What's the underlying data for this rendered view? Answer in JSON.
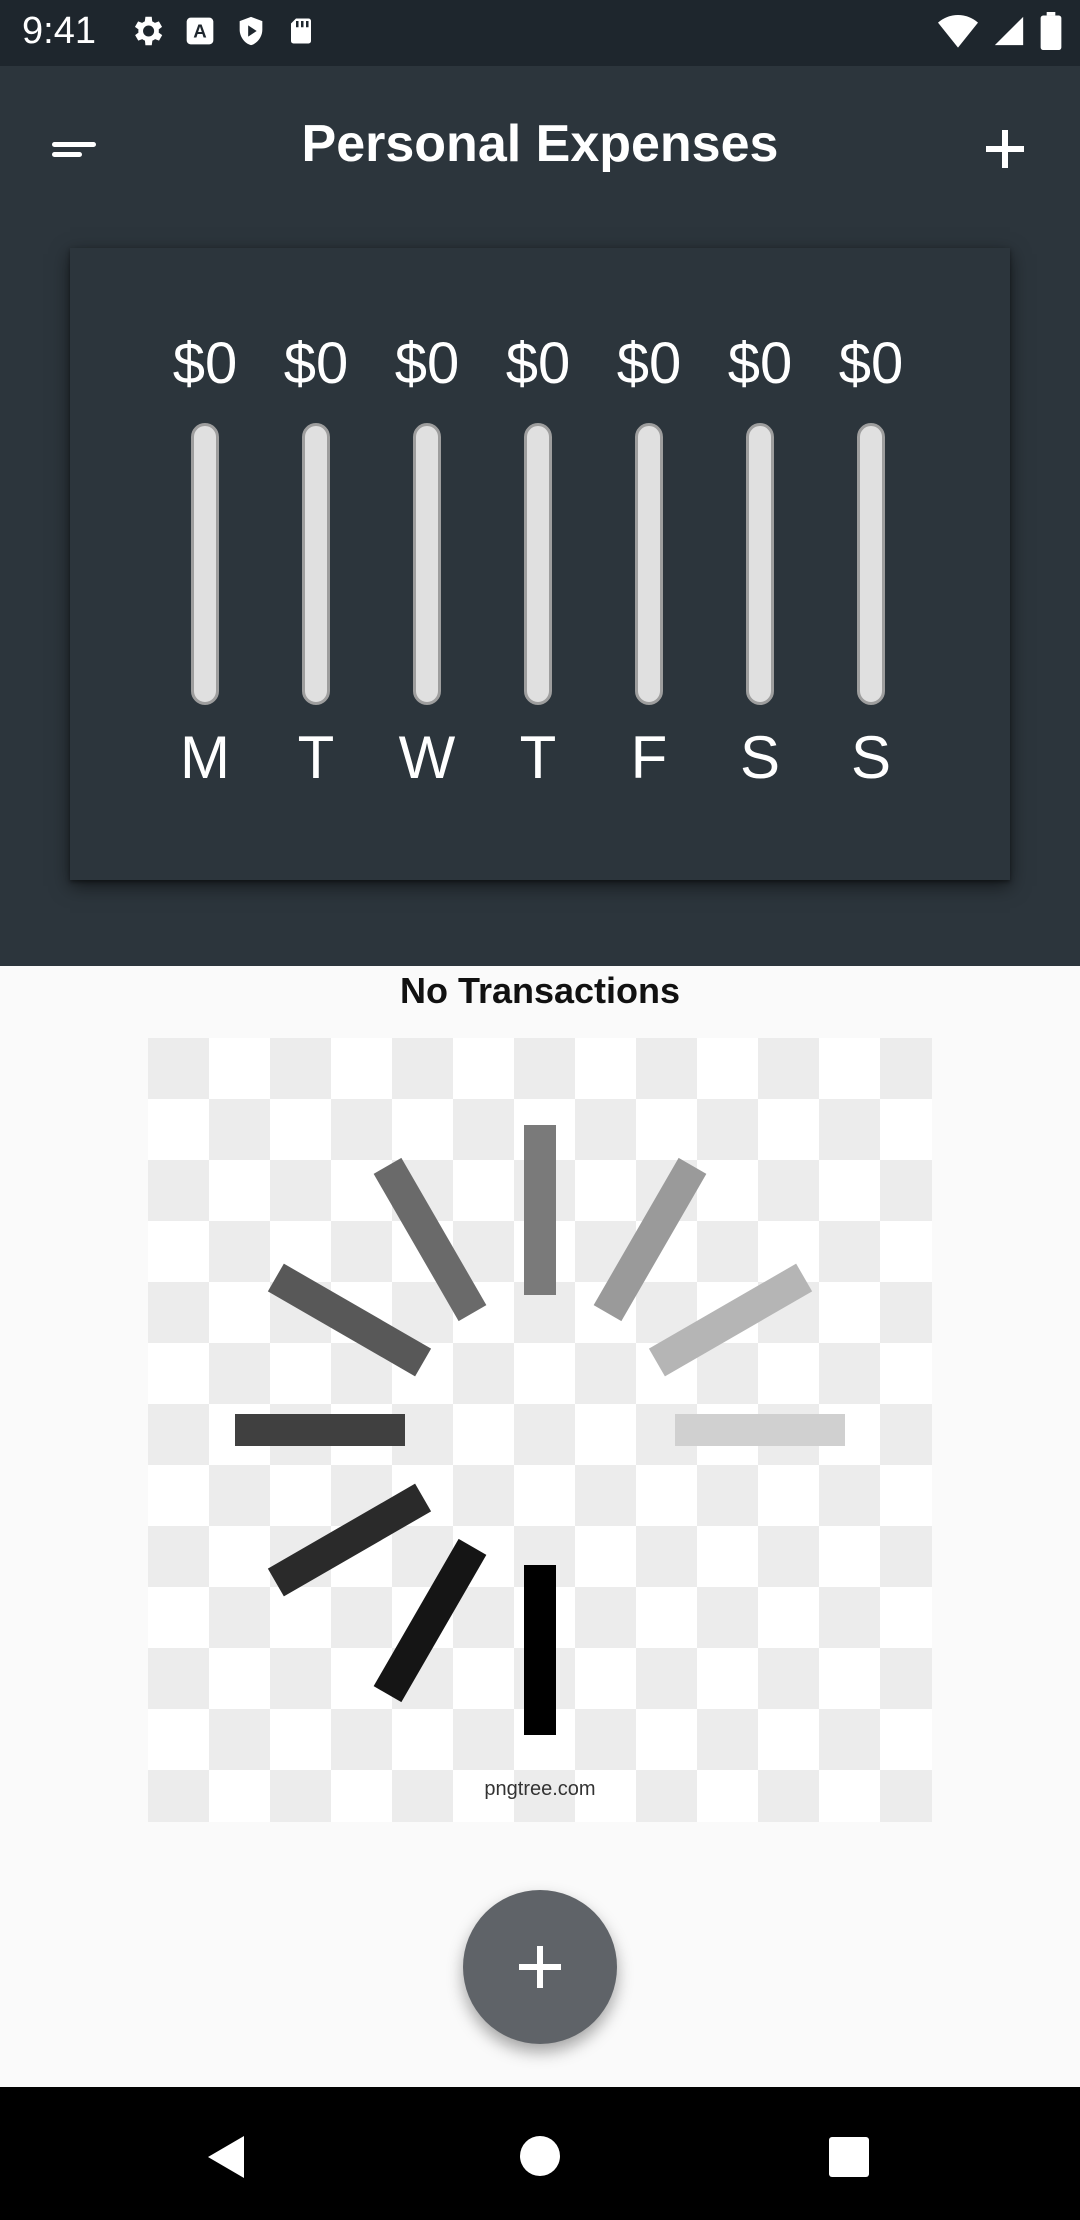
{
  "status_bar": {
    "time": "9:41",
    "left_icons": [
      "settings-icon",
      "font-icon",
      "shield-play-icon",
      "sd-card-icon"
    ],
    "right_icons": [
      "wifi-icon",
      "signal-icon",
      "battery-icon"
    ]
  },
  "app_bar": {
    "title": "Personal Expenses",
    "menu_icon": "menu-icon",
    "add_icon": "add-icon"
  },
  "chart_data": {
    "type": "bar",
    "categories": [
      "M",
      "T",
      "W",
      "T",
      "F",
      "S",
      "S"
    ],
    "value_labels": [
      "$0",
      "$0",
      "$0",
      "$0",
      "$0",
      "$0",
      "$0"
    ],
    "values": [
      0,
      0,
      0,
      0,
      0,
      0,
      0
    ],
    "fill_fraction": [
      0,
      0,
      0,
      0,
      0,
      0,
      0
    ]
  },
  "empty_state": {
    "message": "No Transactions",
    "image_caption": "pngtree.com"
  },
  "fab": {
    "icon": "add-icon"
  },
  "nav_bar": {
    "icons": [
      "back-icon",
      "home-icon",
      "recents-icon"
    ]
  }
}
